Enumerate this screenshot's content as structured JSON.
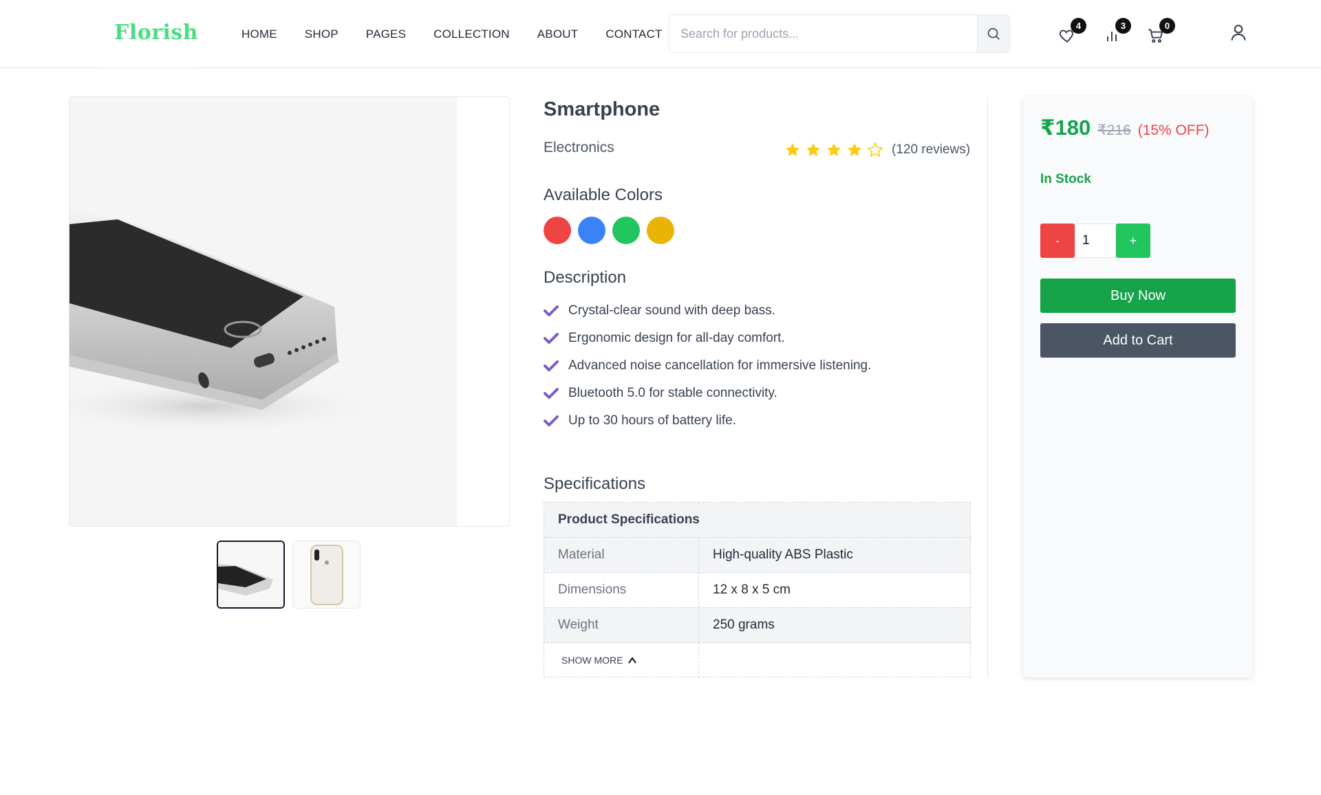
{
  "header": {
    "logo": "Florish",
    "nav": [
      "HOME",
      "SHOP",
      "PAGES",
      "COLLECTION",
      "ABOUT",
      "CONTACT"
    ],
    "search_placeholder": "Search for products...",
    "wishlist_count": "4",
    "compare_count": "3",
    "cart_count": "0",
    "icons": [
      "search-icon",
      "heart-icon",
      "bar-chart-icon",
      "cart-icon",
      "user-icon"
    ]
  },
  "product": {
    "title": "Smartphone",
    "category": "Electronics",
    "rating": 4,
    "rating_max": 5,
    "reviews": "(120 reviews)",
    "colors_title": "Available Colors",
    "colors": [
      "#ef4444",
      "#3b82f6",
      "#22c55e",
      "#eab308"
    ],
    "description_title": "Description",
    "features": [
      "Crystal-clear sound with deep bass.",
      "Ergonomic design for all-day comfort.",
      "Advanced noise cancellation for immersive listening.",
      "Bluetooth 5.0 for stable connectivity.",
      "Up to 30 hours of battery life."
    ]
  },
  "specs": {
    "title": "Specifications",
    "table_header": "Product Specifications",
    "rows": [
      {
        "key": "Material",
        "value": "High-quality ABS Plastic"
      },
      {
        "key": "Dimensions",
        "value": "12 x 8 x 5 cm"
      },
      {
        "key": "Weight",
        "value": "250 grams"
      }
    ],
    "show_more": "SHOW MORE"
  },
  "purchase": {
    "price": "₹180",
    "mrp": "₹216",
    "discount": "(15% OFF)",
    "stock": "In Stock",
    "minus": "-",
    "plus": "+",
    "quantity": "1",
    "buy_now": "Buy Now",
    "add_to_cart": "Add to Cart"
  },
  "colors": {
    "brand": "#4ade80",
    "price": "#16a34a",
    "discount": "#ef4444",
    "check": "#7c5cc4",
    "star": "#facc15"
  }
}
